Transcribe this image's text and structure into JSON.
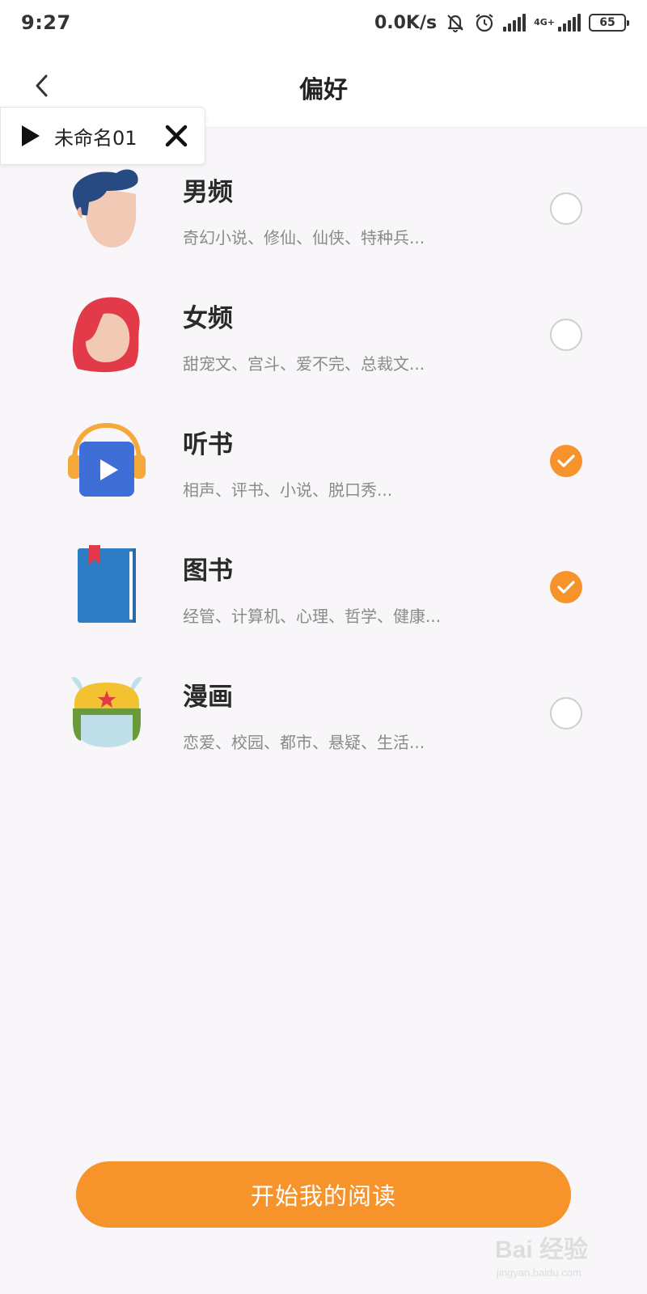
{
  "status_bar": {
    "time": "9:27",
    "net_speed": "0.0K/s",
    "net_type": "4G+",
    "battery": "65",
    "icons": [
      "mute-bell-icon",
      "alarm-icon",
      "signal-icon",
      "signal-4g-icon",
      "battery-icon"
    ]
  },
  "header": {
    "title": "偏好",
    "back_icon": "chevron-left-icon"
  },
  "recorder": {
    "name": "未命名01",
    "play_icon": "play-icon",
    "close_icon": "close-icon"
  },
  "items": [
    {
      "title": "男频",
      "subtitle": "奇幻小说、修仙、仙侠、特种兵...",
      "checked": false,
      "icon": "male-avatar-icon"
    },
    {
      "title": "女频",
      "subtitle": "甜宠文、宫斗、爱不完、总裁文...",
      "checked": false,
      "icon": "female-avatar-icon"
    },
    {
      "title": "听书",
      "subtitle": "相声、评书、小说、脱口秀...",
      "checked": true,
      "icon": "headphone-play-icon"
    },
    {
      "title": "图书",
      "subtitle": "经管、计算机、心理、哲学、健康...",
      "checked": true,
      "icon": "book-icon"
    },
    {
      "title": "漫画",
      "subtitle": "恋爱、校园、都市、悬疑、生活...",
      "checked": false,
      "icon": "comic-character-icon"
    }
  ],
  "start_button": {
    "label": "开始我的阅读"
  },
  "watermark": {
    "main": "Bai 经验",
    "sub": "jingyan.baidu.com"
  },
  "colors": {
    "accent": "#f7932b",
    "background": "#f8f6f9"
  }
}
